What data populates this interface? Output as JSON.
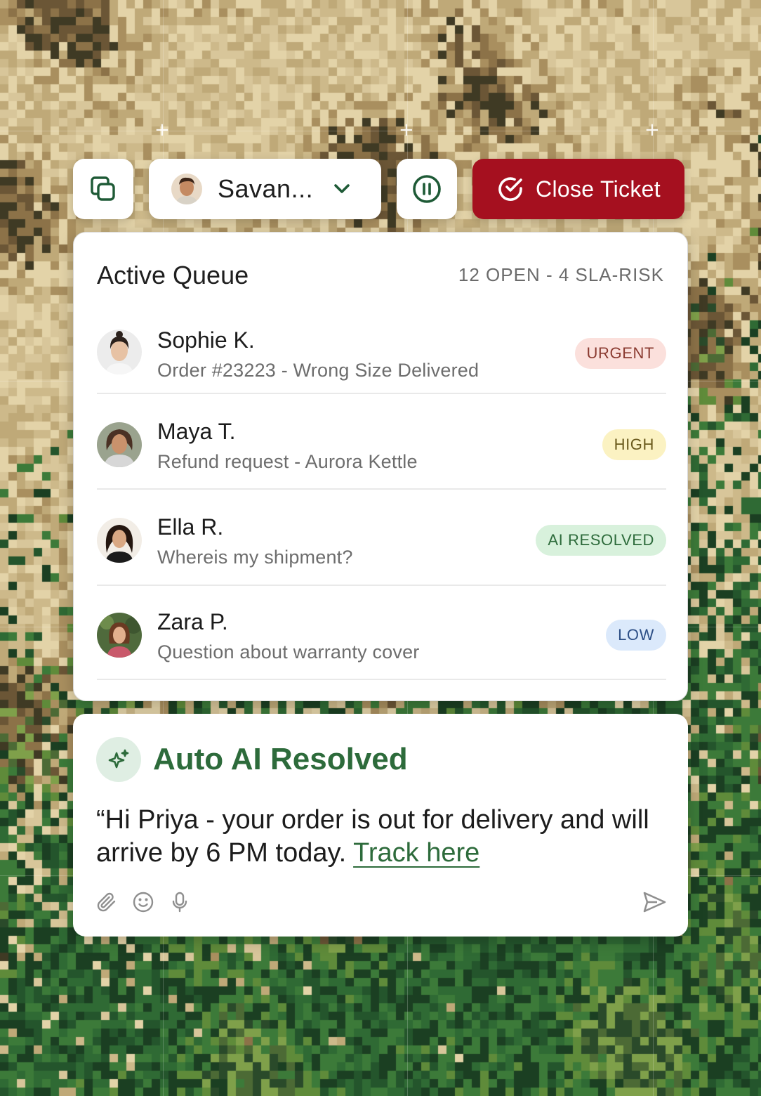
{
  "colors": {
    "brand_green": "#2d6b3b",
    "close_button": "#a5101f",
    "urgent_bg": "#fbe0dc",
    "urgent_fg": "#8a3a30",
    "high_bg": "#fbf2c2",
    "high_fg": "#6a5a1c",
    "ai_resolved_bg": "#d8f1dc",
    "ai_resolved_fg": "#2d6b3b",
    "low_bg": "#dbe9fb",
    "low_fg": "#2d4f86"
  },
  "toolbar": {
    "copy_icon": "copy-icon",
    "agent_name": "Savan...",
    "dropdown_icon": "chevron-down-icon",
    "pause_icon": "pause-circle-icon",
    "close_label": "Close Ticket",
    "close_icon": "check-circle-icon"
  },
  "queue": {
    "title": "Active Queue",
    "stats": "12 OPEN - 4 SLA-RISK",
    "items": [
      {
        "name": "Sophie K.",
        "subject": "Order #23223 - Wrong Size Delivered",
        "badge": "URGENT"
      },
      {
        "name": "Maya T.",
        "subject": "Refund request - Aurora Kettle",
        "badge": "HIGH"
      },
      {
        "name": "Ella R.",
        "subject": "Whereis my shipment?",
        "badge": "AI RESOLVED"
      },
      {
        "name": "Zara P.",
        "subject": "Question about warranty cover",
        "badge": "LOW"
      }
    ]
  },
  "ai_card": {
    "icon": "sparkle-icon",
    "title": "Auto AI Resolved",
    "message": "“Hi Priya - your order is out for delivery and will arrive by 6 PM today. ",
    "link": "Track here",
    "tools": [
      "paperclip-icon",
      "smiley-icon",
      "microphone-icon"
    ],
    "send_icon": "send-icon"
  }
}
